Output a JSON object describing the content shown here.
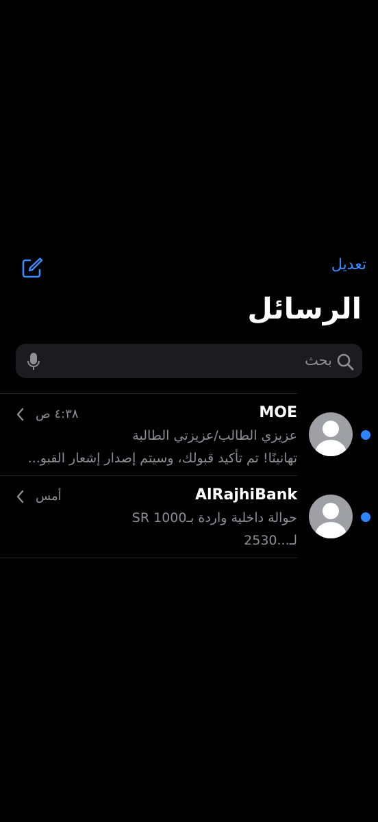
{
  "header": {
    "edit_label": "تعديل",
    "title": "الرسائل",
    "compose_icon": "compose-icon"
  },
  "search": {
    "placeholder": "بحث",
    "search_icon": "search-icon",
    "mic_icon": "mic-icon"
  },
  "threads": [
    {
      "sender": "MOE",
      "time": "٤:٣٨ ص",
      "preview_line1": "عزيزي الطالب/عزيزتي الطالبة",
      "preview_line2": "تهانينًا! تم تأكيد قبولك، وسيتم إصدار إشعار القبو...",
      "unread": true
    },
    {
      "sender": "AlRajhiBank",
      "time": "أمس",
      "preview_line1": "حوالة داخلية واردة بـ1000 SR",
      "preview_line2": "لـ...2530",
      "unread": true
    }
  ],
  "colors": {
    "background": "#000000",
    "accent": "#3a8dff",
    "unread_dot": "#2b86ff",
    "secondary_text": "#8e8e93",
    "search_field": "#1c1c1e",
    "avatar": "#9ea0a6"
  }
}
